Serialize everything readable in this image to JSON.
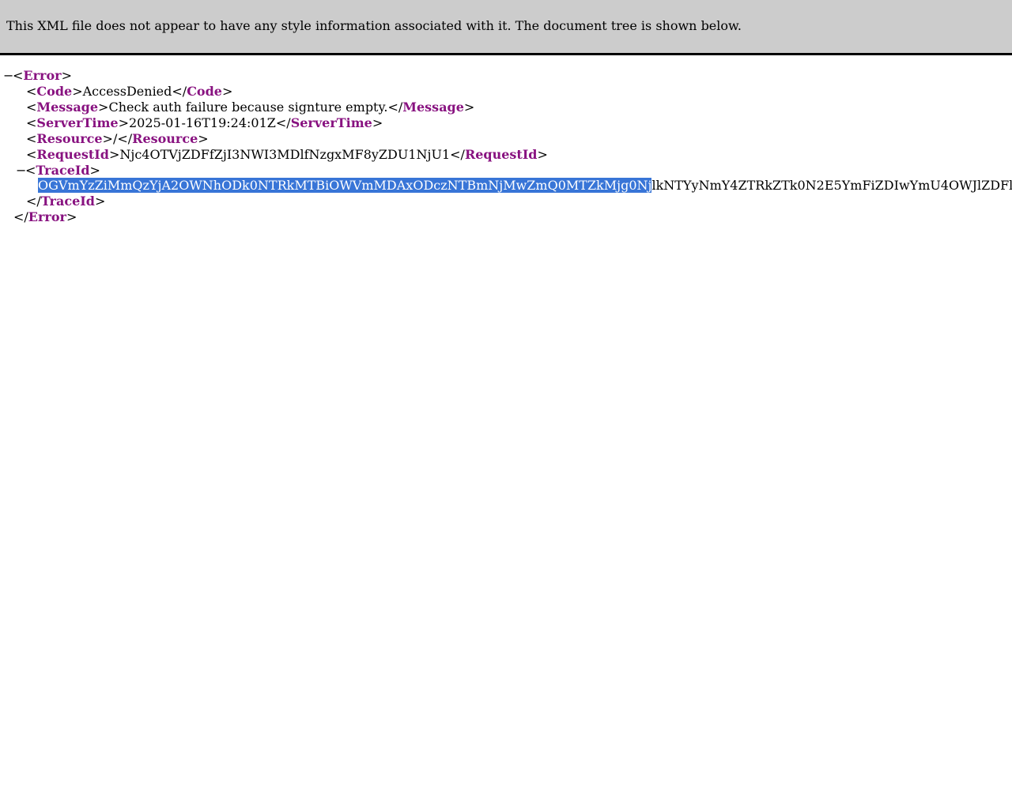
{
  "banner": {
    "message": "This XML file does not appear to have any style information associated with it. The document tree is shown below."
  },
  "tree": {
    "collapse_glyph": "−",
    "root_tag": "Error",
    "code": {
      "tag": "Code",
      "value": "AccessDenied"
    },
    "message": {
      "tag": "Message",
      "value": "Check auth failure because signture empty."
    },
    "server_time": {
      "tag": "ServerTime",
      "value": "2025-01-16T19:24:01Z"
    },
    "resource": {
      "tag": "Resource",
      "value": "/"
    },
    "request_id": {
      "tag": "RequestId",
      "value": "Njc4OTVjZDFfZjI3NWI3MDlfNzgxMF8yZDU1NjU1"
    },
    "trace_id": {
      "tag": "TraceId",
      "value_selected": "OGVmYzZiMmQzYjA2OWNhODk0NTRkMTBiOWVmMDAxODczNTBmNjMwZmQ0MTZkMjg0Nj",
      "value_rest": "lkNTYyNmY4ZTRkZTk0N2E5YmFiZDIwYmU4OWJlZDFl"
    }
  }
}
